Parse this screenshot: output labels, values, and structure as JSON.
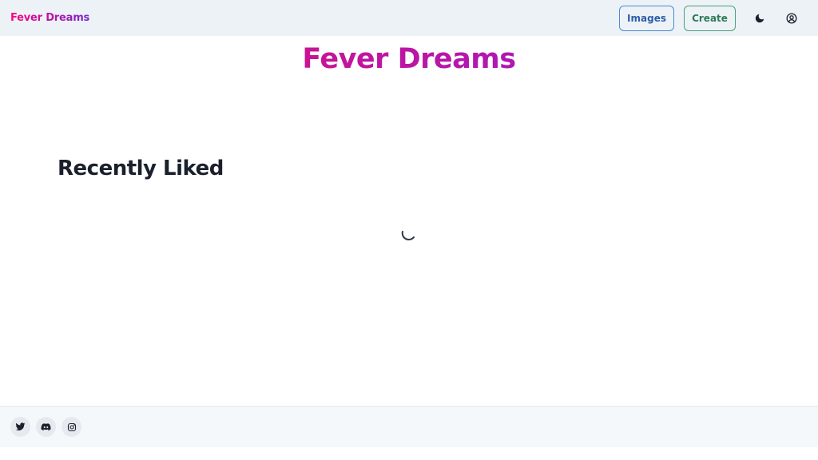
{
  "navbar": {
    "logo": "Fever Dreams",
    "images_label": "Images",
    "create_label": "Create",
    "theme_toggle_icon": "moon-icon",
    "account_icon": "user-circle-icon"
  },
  "main": {
    "title": "Fever Dreams",
    "section_title": "Recently Liked",
    "loading_icon": "spinner-icon"
  },
  "footer": {
    "social_links": [
      {
        "name": "Twitter",
        "icon": "twitter-icon"
      },
      {
        "name": "Discord",
        "icon": "discord-icon"
      },
      {
        "name": "Instagram",
        "icon": "instagram-icon"
      }
    ]
  },
  "colors": {
    "brand_gradient_start": "#ff0080",
    "brand_gradient_end": "#7928ca",
    "title": "#c0159f",
    "images_border": "#4a89d6",
    "create_border": "#48a17a"
  }
}
